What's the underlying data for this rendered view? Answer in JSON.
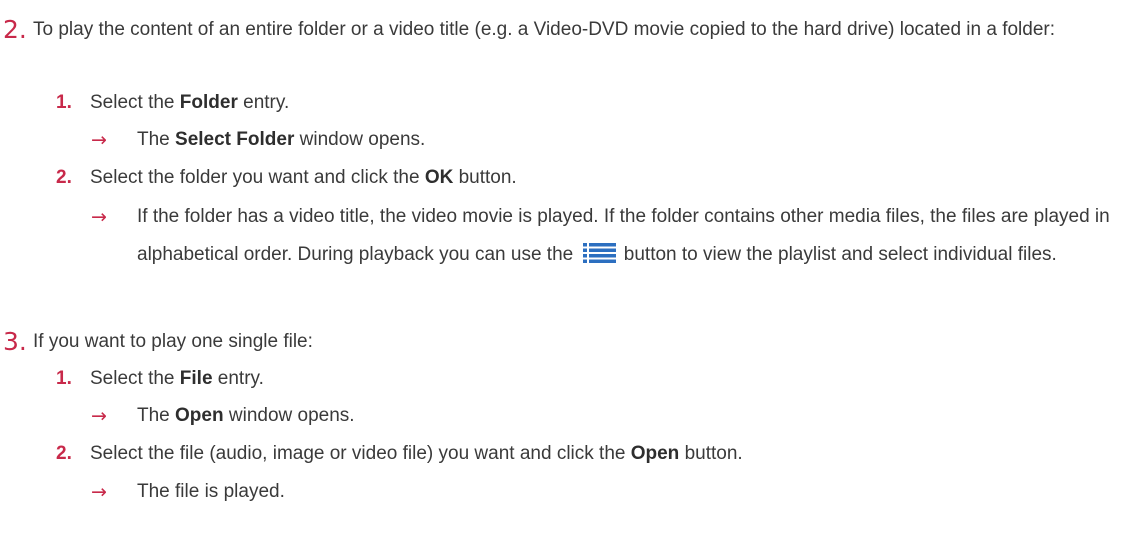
{
  "step2": {
    "number": "2.",
    "text": "To play the content of an entire folder or a video title (e.g. a Video-DVD movie copied to the hard drive) located in a folder:",
    "sub1": {
      "number": "1.",
      "pre": "Select the ",
      "bold": "Folder",
      "post": " entry.",
      "result": {
        "pre": "The ",
        "bold": "Select Folder",
        "post": " window opens."
      }
    },
    "sub2": {
      "number": "2.",
      "pre": "Select the folder you want and click the ",
      "bold": "OK",
      "post": " button.",
      "result": {
        "text_a": "If the folder has a video title, the video movie is played. If the folder contains other media files, the files are played in alphabetical order. During playback you can use the",
        "icon": "playlist-icon",
        "text_b": "button to view the playlist and select individual files."
      }
    }
  },
  "step3": {
    "number": "3.",
    "text": "If you want to play one single file:",
    "sub1": {
      "number": "1.",
      "pre": "Select the ",
      "bold": "File",
      "post": " entry.",
      "result": {
        "pre": "The ",
        "bold": "Open",
        "post": " window opens."
      }
    },
    "sub2": {
      "number": "2.",
      "pre": "Select the file (audio, image or video file) you want and click the ",
      "bold": "Open",
      "post": " button.",
      "result": {
        "text": "The file is played."
      }
    }
  },
  "colors": {
    "accent": "#c8294a",
    "text": "#3a3a3a"
  },
  "arrow_glyph": "→"
}
